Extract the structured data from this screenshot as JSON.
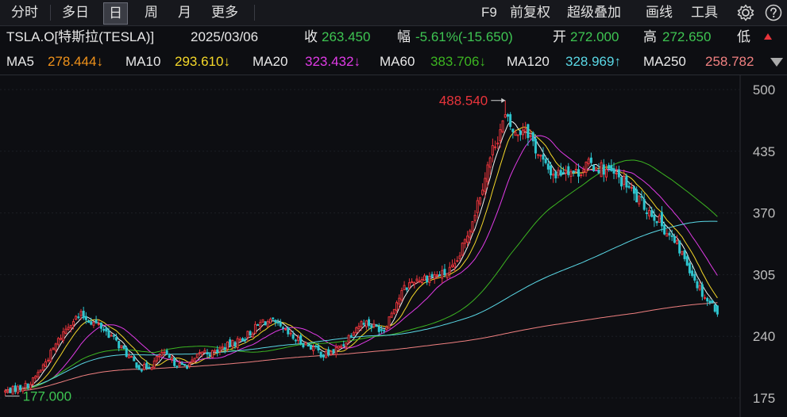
{
  "toolbar": {
    "tabs": [
      "分时",
      "多日",
      "日",
      "周",
      "月",
      "更多"
    ],
    "active_tab": "日",
    "right": [
      "F9",
      "前复权",
      "超级叠加",
      "画线",
      "工具"
    ],
    "icons": [
      "gear-icon",
      "help-icon"
    ]
  },
  "quote": {
    "symbol": "TSLA.O[特斯拉(TESLA)]",
    "date": "2025/03/06",
    "close_label": "收",
    "close": "263.450",
    "change_label": "幅",
    "change": "-5.61%(-15.650)",
    "open_label": "开",
    "open": "272.000",
    "high_label": "高",
    "high": "272.650",
    "low_label": "低"
  },
  "ma": {
    "ma5_label": "MA5",
    "ma5": "278.444↓",
    "ma10_label": "MA10",
    "ma10": "293.610↓",
    "ma20_label": "MA20",
    "ma20": "323.432↓",
    "ma60_label": "MA60",
    "ma60": "383.706↓",
    "ma120_label": "MA120",
    "ma120": "328.969↑",
    "ma250_label": "MA250",
    "ma250": "258.782"
  },
  "colors": {
    "up": "#e8343b",
    "down": "#2ec5cf",
    "ma5": "#f2f2f2",
    "ma10": "#f5d829",
    "ma20": "#e03be6",
    "ma60": "#3cb521",
    "ma120": "#5ad8e6",
    "ma250": "#f08080",
    "orange": "#f0921a",
    "green_text": "#3ec552",
    "red_text": "#e8343b"
  },
  "chart_data": {
    "type": "candlestick",
    "y_ticks": [
      "500",
      "435",
      "370",
      "305",
      "240",
      "175"
    ],
    "ylim": [
      175,
      500
    ],
    "annotations": {
      "high_label": "488.540",
      "high_value": 488.54,
      "low_label": "177.000",
      "low_value": 177.0
    },
    "anchors": [
      [
        0,
        182
      ],
      [
        6,
        186
      ],
      [
        10,
        190
      ],
      [
        14,
        205
      ],
      [
        18,
        222
      ],
      [
        22,
        240
      ],
      [
        26,
        256
      ],
      [
        30,
        262
      ],
      [
        34,
        256
      ],
      [
        38,
        250
      ],
      [
        42,
        240
      ],
      [
        46,
        228
      ],
      [
        50,
        215
      ],
      [
        54,
        206
      ],
      [
        58,
        210
      ],
      [
        62,
        222
      ],
      [
        66,
        214
      ],
      [
        70,
        208
      ],
      [
        74,
        212
      ],
      [
        78,
        224
      ],
      [
        82,
        222
      ],
      [
        86,
        228
      ],
      [
        90,
        232
      ],
      [
        94,
        238
      ],
      [
        98,
        246
      ],
      [
        102,
        256
      ],
      [
        106,
        254
      ],
      [
        110,
        246
      ],
      [
        114,
        238
      ],
      [
        118,
        233
      ],
      [
        122,
        228
      ],
      [
        126,
        220
      ],
      [
        130,
        224
      ],
      [
        134,
        232
      ],
      [
        138,
        248
      ],
      [
        142,
        256
      ],
      [
        146,
        250
      ],
      [
        150,
        248
      ],
      [
        154,
        272
      ],
      [
        158,
        290
      ],
      [
        162,
        300
      ],
      [
        166,
        302
      ],
      [
        170,
        304
      ],
      [
        174,
        306
      ],
      [
        178,
        312
      ],
      [
        182,
        340
      ],
      [
        186,
        372
      ],
      [
        190,
        410
      ],
      [
        194,
        445
      ],
      [
        198,
        470
      ],
      [
        202,
        452
      ],
      [
        206,
        462
      ],
      [
        210,
        438
      ],
      [
        214,
        418
      ],
      [
        218,
        410
      ],
      [
        222,
        418
      ],
      [
        226,
        412
      ],
      [
        230,
        420
      ],
      [
        234,
        420
      ],
      [
        238,
        415
      ],
      [
        242,
        408
      ],
      [
        246,
        400
      ],
      [
        250,
        385
      ],
      [
        254,
        375
      ],
      [
        258,
        365
      ],
      [
        262,
        350
      ],
      [
        266,
        335
      ],
      [
        270,
        318
      ],
      [
        274,
        295
      ],
      [
        278,
        278
      ],
      [
        282,
        268
      ]
    ]
  }
}
